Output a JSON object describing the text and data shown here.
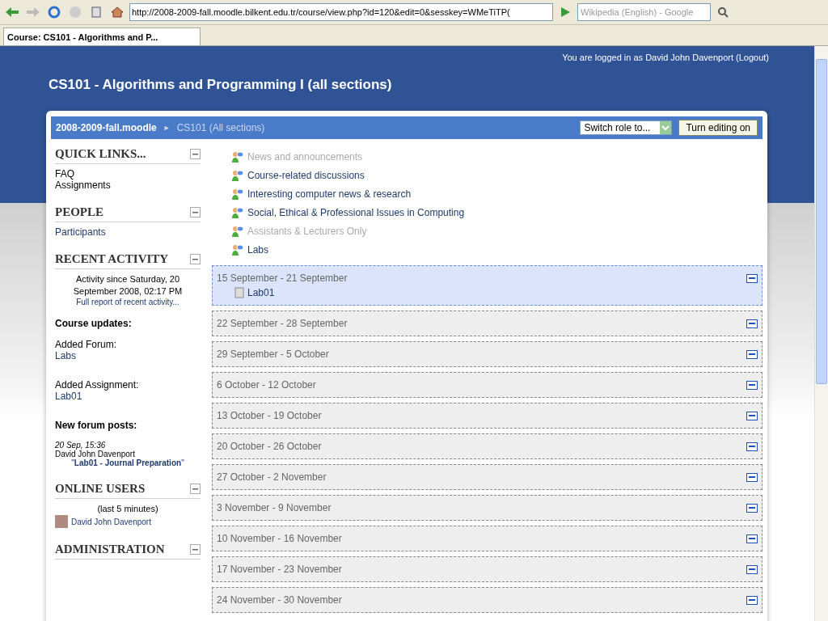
{
  "browser": {
    "url": "http://2008-2009-fall.moodle.bilkent.edu.tr/course/view.php?id=120&edit=0&sesskey=WMeTiTP(",
    "search_placeholder": "Wikipedia (English) - Google",
    "tab_title": "Course: CS101 - Algorithms and P..."
  },
  "login_info": "You are logged in as David John Davenport (Logout)",
  "course_title": "CS101 - Algorithms and Programming I (all sections)",
  "breadcrumb": {
    "home": "2008-2009-fall.moodle",
    "separator": "►",
    "current": "CS101 (All sections)"
  },
  "switch_role": "Switch role to...",
  "edit_button": "Turn editing on",
  "sidebar": [
    {
      "kind": "links",
      "title": "QUICK LINKS...",
      "items": [
        {
          "text": "FAQ",
          "plain": true
        },
        {
          "text": "Assignments",
          "plain": true
        }
      ]
    },
    {
      "kind": "links",
      "title": "PEOPLE",
      "items": [
        {
          "text": "Participants",
          "plain": false
        }
      ]
    },
    {
      "kind": "recent",
      "title": "RECENT ACTIVITY",
      "since": "Activity since Saturday, 20 September 2008, 02:17 PM",
      "report_link": "Full report of recent activity...",
      "updates_heading": "Course updates:",
      "updates": [
        {
          "label": "Added Forum:",
          "link": "Labs"
        },
        {
          "label": "Added Assignment:",
          "link": "Lab01"
        }
      ],
      "posts_heading": "New forum posts:",
      "post": {
        "date": "20 Sep, 15:36",
        "author": "David John Davenport",
        "title": "\"**Lab01 - Journal Preparation**\""
      }
    },
    {
      "kind": "online",
      "title": "ONLINE USERS",
      "period": "(last 5 minutes)",
      "users": [
        "David John Davenport"
      ]
    },
    {
      "kind": "links",
      "title": "ADMINISTRATION"
    }
  ],
  "forums": [
    {
      "name": "News and announcements",
      "hidden": true
    },
    {
      "name": "Course-related discussions",
      "hidden": false
    },
    {
      "name": "Interesting computer news & research",
      "hidden": false
    },
    {
      "name": "Social, Ethical & Professional Issues in Computing",
      "hidden": false
    },
    {
      "name": "Assistants & Lecturers Only",
      "hidden": true
    },
    {
      "name": "Labs",
      "hidden": false
    }
  ],
  "weeks": [
    {
      "dates": "15 September - 21 September",
      "current": true,
      "activities": [
        "Lab01"
      ]
    },
    {
      "dates": "22 September - 28 September",
      "current": false
    },
    {
      "dates": "29 September - 5 October",
      "current": false
    },
    {
      "dates": "6 October - 12 October",
      "current": false
    },
    {
      "dates": "13 October - 19 October",
      "current": false
    },
    {
      "dates": "20 October - 26 October",
      "current": false
    },
    {
      "dates": "27 October - 2 November",
      "current": false
    },
    {
      "dates": "3 November - 9 November",
      "current": false
    },
    {
      "dates": "10 November - 16 November",
      "current": false
    },
    {
      "dates": "17 November - 23 November",
      "current": false
    },
    {
      "dates": "24 November - 30 November",
      "current": false
    }
  ]
}
